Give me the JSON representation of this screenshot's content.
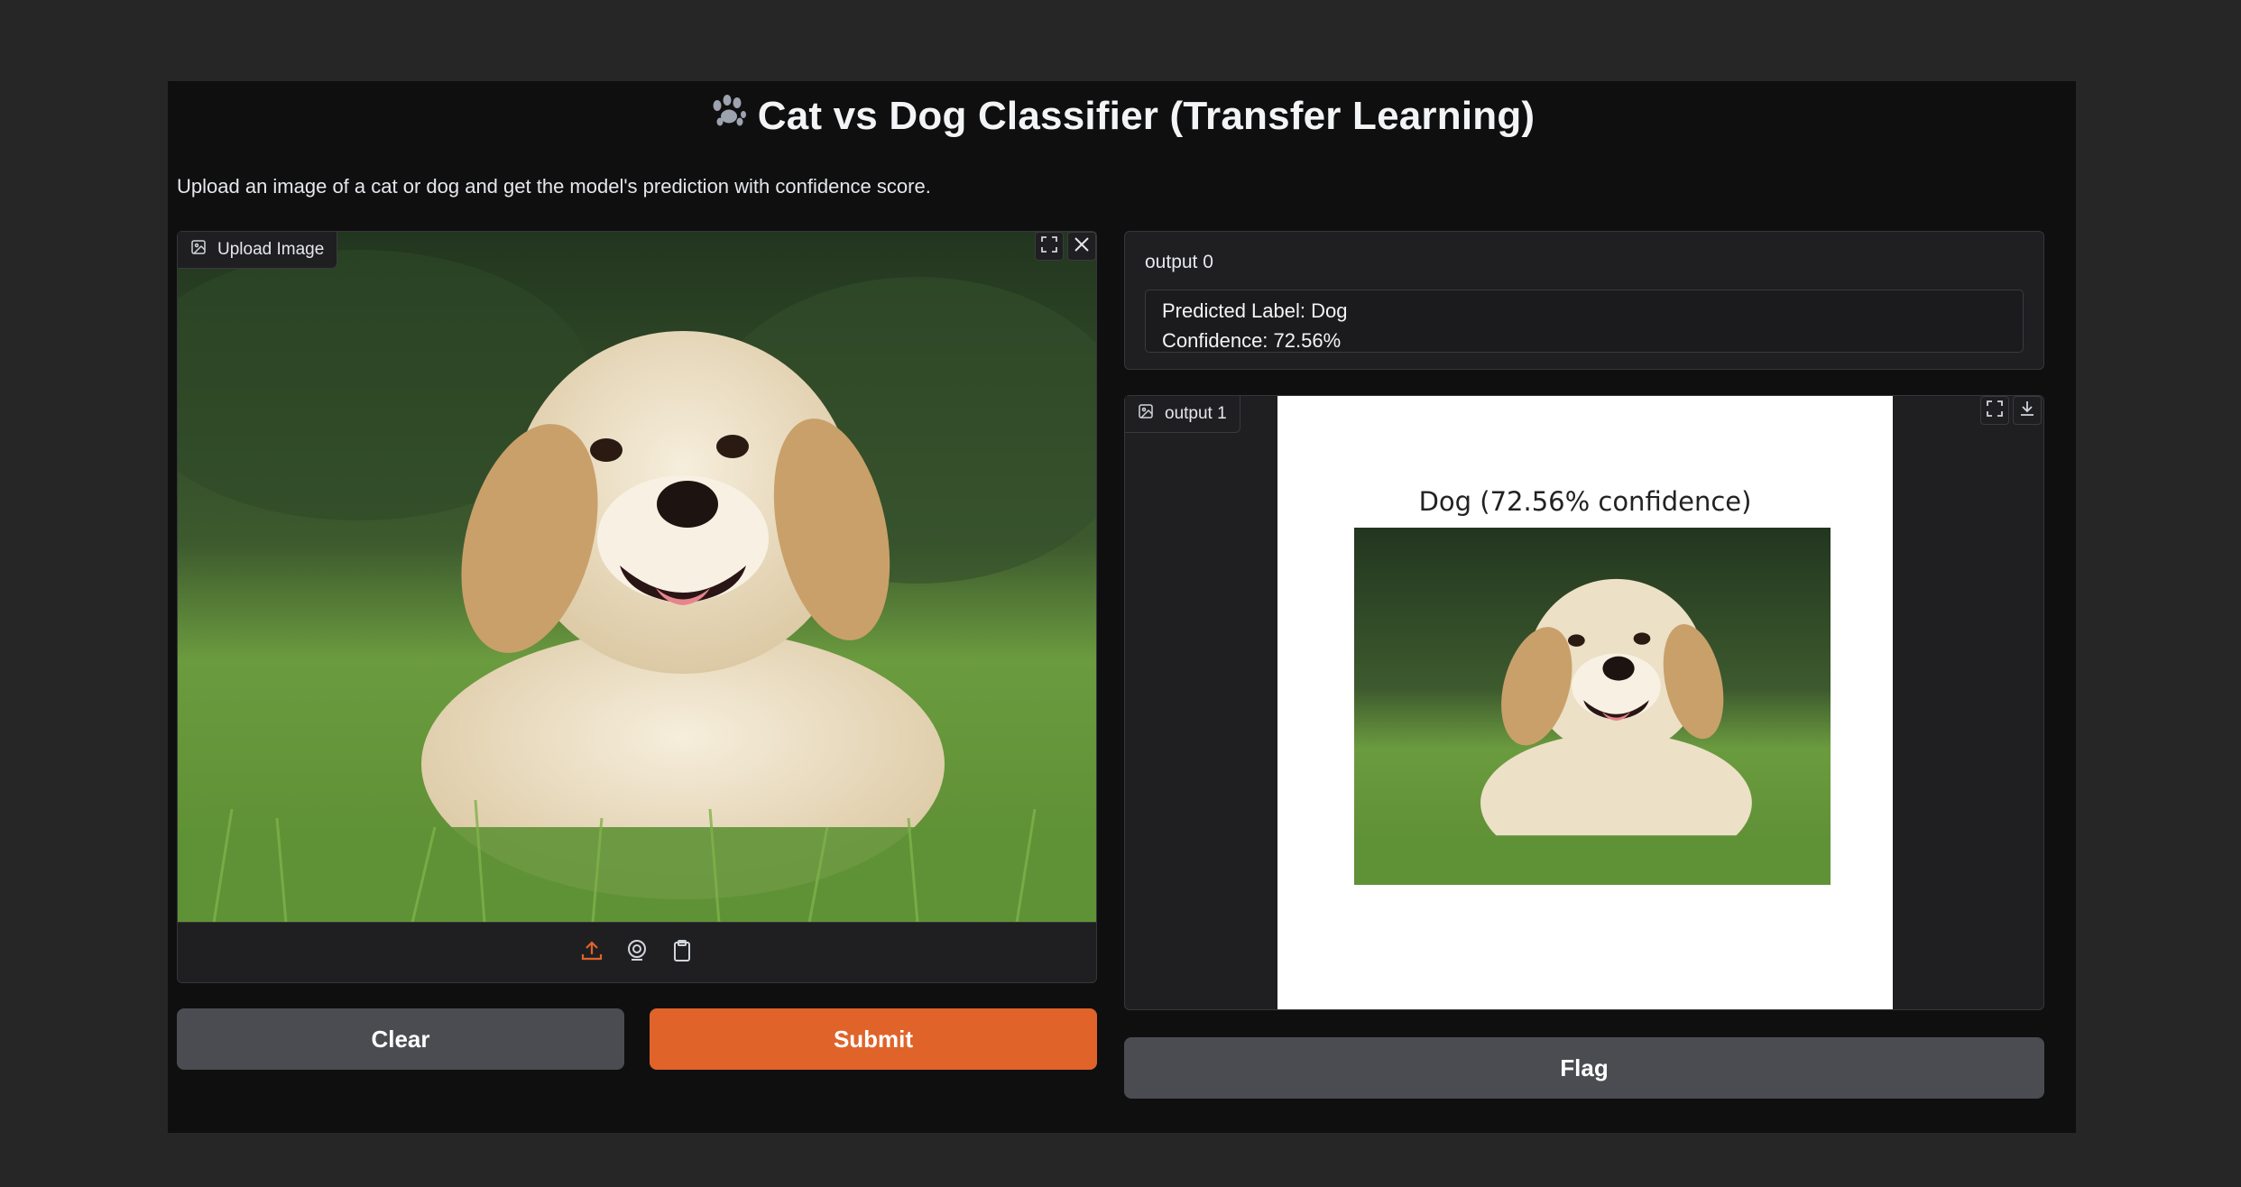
{
  "header": {
    "title": "Cat vs Dog Classifier (Transfer Learning)",
    "description": "Upload an image of a cat or dog and get the model's prediction with confidence score."
  },
  "input_image": {
    "label": "Upload Image",
    "icons": [
      "image-icon",
      "fullscreen-icon",
      "close-icon",
      "upload-icon",
      "webcam-icon",
      "clipboard-icon"
    ]
  },
  "buttons": {
    "clear": "Clear",
    "submit": "Submit",
    "flag": "Flag"
  },
  "output0": {
    "label": "output 0",
    "line1": "Predicted Label: Dog",
    "line2": "Confidence: 72.56%"
  },
  "output1": {
    "label": "output 1",
    "plot_title": "Dog (72.56% confidence)",
    "icons": [
      "image-icon",
      "fullscreen-icon",
      "download-icon"
    ]
  },
  "colors": {
    "accent": "#e0632a",
    "background": "#0f0f10",
    "panel": "#1f1f22"
  }
}
